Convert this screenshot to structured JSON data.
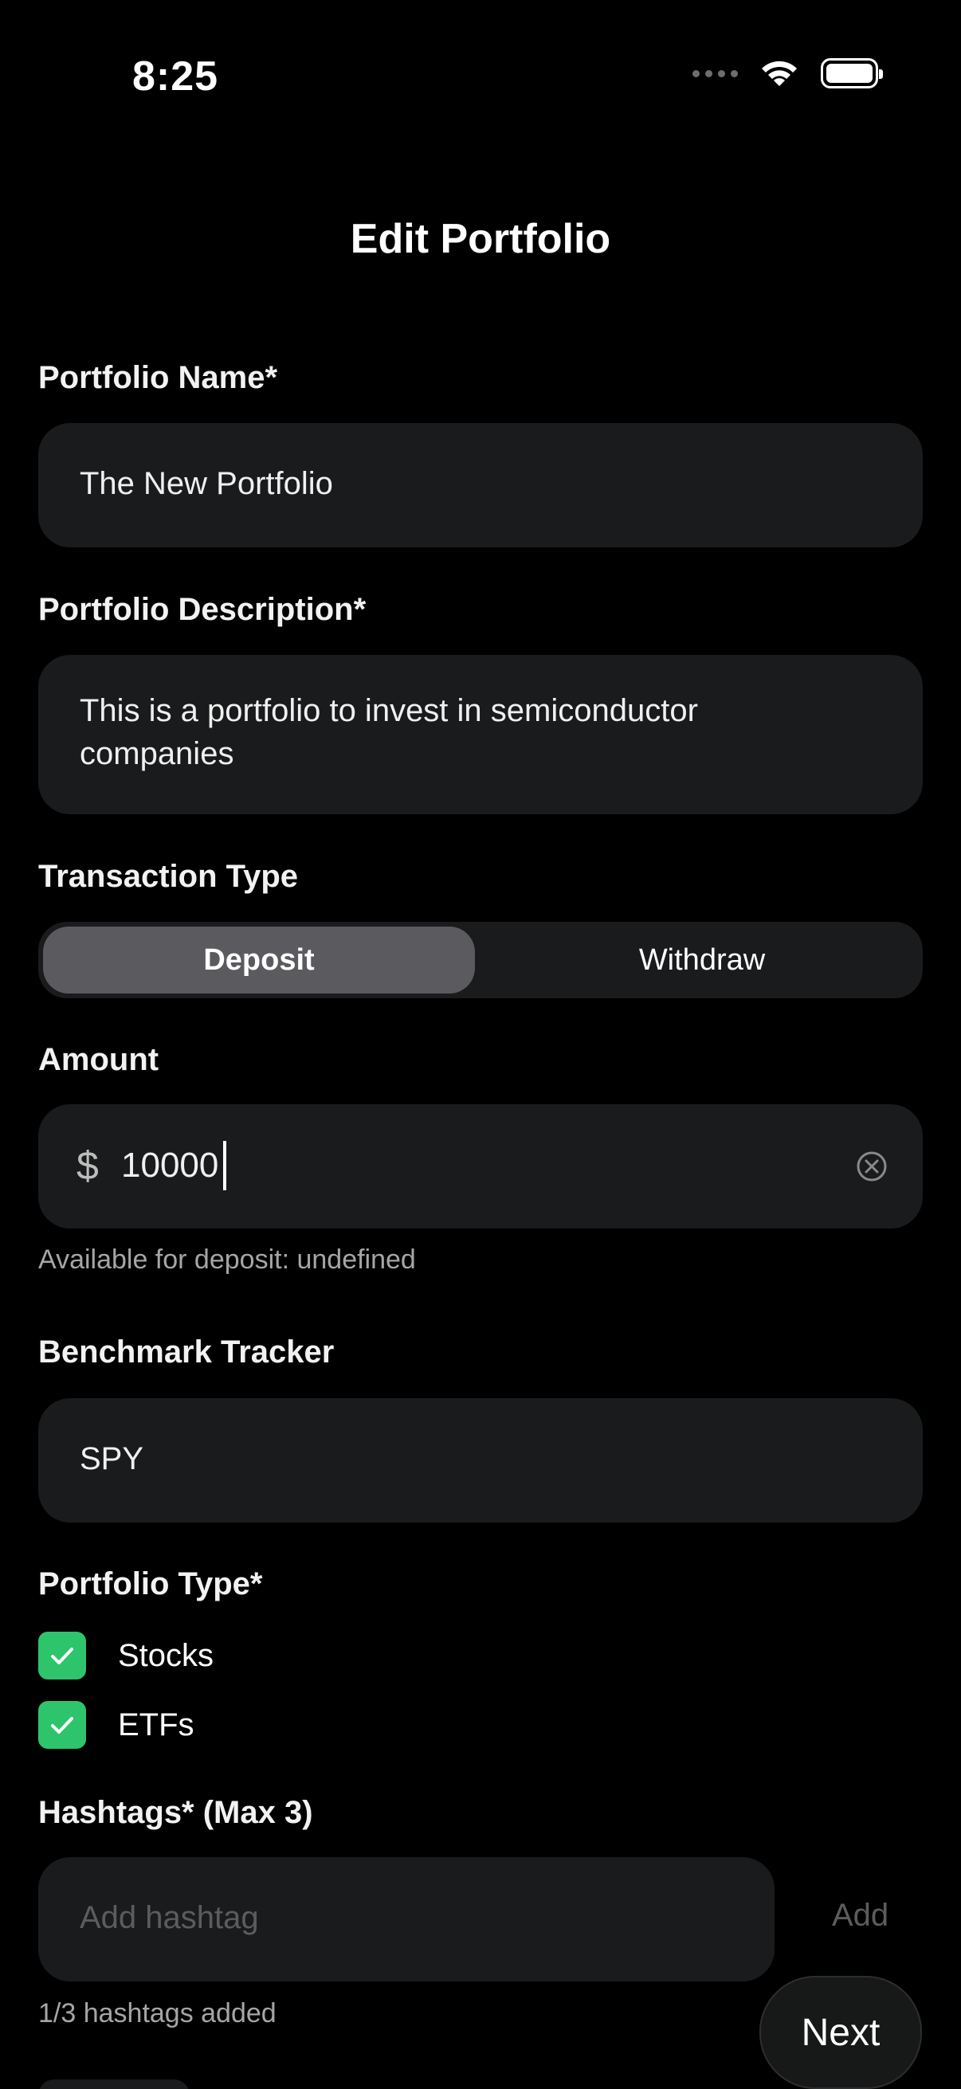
{
  "status_bar": {
    "time": "8:25"
  },
  "header": {
    "title": "Edit Portfolio"
  },
  "form": {
    "name": {
      "label": "Portfolio Name*",
      "value": "The New Portfolio"
    },
    "description": {
      "label": "Portfolio Description*",
      "value_line1": "This is a portfolio to invest in semiconductor",
      "value_line2": "companies"
    },
    "transaction_type": {
      "label": "Transaction Type",
      "options": [
        "Deposit",
        "Withdraw"
      ],
      "selected": "Deposit"
    },
    "amount": {
      "label": "Amount",
      "currency_symbol": "$",
      "value": "10000",
      "hint": "Available for deposit: undefined"
    },
    "benchmark": {
      "label": "Benchmark Tracker",
      "value": "SPY"
    },
    "portfolio_type": {
      "label": "Portfolio Type*",
      "options": [
        "Stocks",
        "ETFs"
      ],
      "checked": [
        true,
        true
      ]
    },
    "hashtags": {
      "label": "Hashtags* (Max 3)",
      "placeholder": "Add hashtag",
      "add_label": "Add",
      "count_text": "1/3 hashtags added"
    }
  },
  "footer": {
    "next_label": "Next"
  },
  "colors": {
    "background": "#000000",
    "field": "#1a1b1c",
    "check_green": "#2ec46c",
    "segment_active": "#5b5b5f"
  }
}
